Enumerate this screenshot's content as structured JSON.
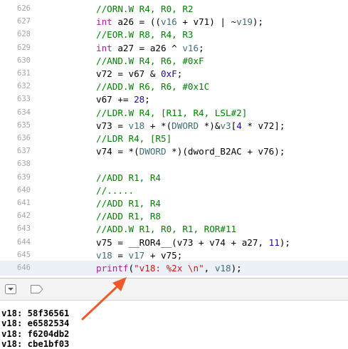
{
  "colors": {
    "comment": "#008000",
    "keyword": "#a3239d",
    "number": "#1c00cf",
    "variable": "#3f6e74",
    "string": "#c41a16",
    "arrow": "#f05a28"
  },
  "editor": {
    "lines": [
      {
        "n": "626",
        "tokens": [
          {
            "t": "//ORN.W R4, R0, R2",
            "c": "comment"
          }
        ]
      },
      {
        "n": "627",
        "tokens": [
          {
            "t": "int",
            "c": "kw"
          },
          {
            "t": " a26 = ((",
            "c": "plain"
          },
          {
            "t": "v16",
            "c": "var"
          },
          {
            "t": " + v71) | ~",
            "c": "plain"
          },
          {
            "t": "v19",
            "c": "var"
          },
          {
            "t": ");",
            "c": "plain"
          }
        ]
      },
      {
        "n": "628",
        "tokens": [
          {
            "t": "//EOR.W R8, R4, R3",
            "c": "comment"
          }
        ]
      },
      {
        "n": "629",
        "tokens": [
          {
            "t": "int",
            "c": "kw"
          },
          {
            "t": " a27 = a26 ^ ",
            "c": "plain"
          },
          {
            "t": "v16",
            "c": "var"
          },
          {
            "t": ";",
            "c": "plain"
          }
        ]
      },
      {
        "n": "630",
        "tokens": [
          {
            "t": "//AND.W R4, R6, #0xF",
            "c": "comment"
          }
        ]
      },
      {
        "n": "631",
        "tokens": [
          {
            "t": "v72 = v67 & ",
            "c": "plain"
          },
          {
            "t": "0xF",
            "c": "num"
          },
          {
            "t": ";",
            "c": "plain"
          }
        ]
      },
      {
        "n": "632",
        "tokens": [
          {
            "t": "//ADD.W R6, R6, #0x1C",
            "c": "comment"
          }
        ]
      },
      {
        "n": "633",
        "tokens": [
          {
            "t": "v67 += ",
            "c": "plain"
          },
          {
            "t": "28",
            "c": "num"
          },
          {
            "t": ";",
            "c": "plain"
          }
        ]
      },
      {
        "n": "634",
        "tokens": [
          {
            "t": "//LDR.W R4, [R11, R4, LSL#2]",
            "c": "comment"
          }
        ]
      },
      {
        "n": "635",
        "tokens": [
          {
            "t": "v73 = ",
            "c": "plain"
          },
          {
            "t": "v18",
            "c": "var"
          },
          {
            "t": " + *(",
            "c": "plain"
          },
          {
            "t": "DWORD",
            "c": "var"
          },
          {
            "t": " *)&",
            "c": "plain"
          },
          {
            "t": "v3",
            "c": "var"
          },
          {
            "t": "[",
            "c": "plain"
          },
          {
            "t": "4",
            "c": "num"
          },
          {
            "t": " * v72];",
            "c": "plain"
          }
        ]
      },
      {
        "n": "636",
        "tokens": [
          {
            "t": "//LDR R4, [R5]",
            "c": "comment"
          }
        ]
      },
      {
        "n": "637",
        "tokens": [
          {
            "t": "v74 = *(",
            "c": "plain"
          },
          {
            "t": "DWORD",
            "c": "var"
          },
          {
            "t": " *)(dword_B2AC + v76);",
            "c": "plain"
          }
        ]
      },
      {
        "n": "638",
        "tokens": []
      },
      {
        "n": "639",
        "tokens": [
          {
            "t": "//ADD R1, R4",
            "c": "comment"
          }
        ]
      },
      {
        "n": "640",
        "tokens": [
          {
            "t": "//.....",
            "c": "comment"
          }
        ]
      },
      {
        "n": "641",
        "tokens": [
          {
            "t": "//ADD R1, R4",
            "c": "comment"
          }
        ]
      },
      {
        "n": "642",
        "tokens": [
          {
            "t": "//ADD R1, R8",
            "c": "comment"
          }
        ]
      },
      {
        "n": "643",
        "tokens": [
          {
            "t": "//ADD.W R1, R0, R1, ROR#11",
            "c": "comment"
          }
        ]
      },
      {
        "n": "644",
        "tokens": [
          {
            "t": "v75 = __ROR4__(v73 + v74 + a27, ",
            "c": "plain"
          },
          {
            "t": "11",
            "c": "num"
          },
          {
            "t": ");",
            "c": "plain"
          }
        ]
      },
      {
        "n": "645",
        "tokens": [
          {
            "t": "v18",
            "c": "var"
          },
          {
            "t": " = ",
            "c": "plain"
          },
          {
            "t": "v17",
            "c": "var"
          },
          {
            "t": " + v75;",
            "c": "plain"
          }
        ]
      },
      {
        "n": "646",
        "tokens": [
          {
            "t": "printf",
            "c": "kw"
          },
          {
            "t": "(",
            "c": "plain"
          },
          {
            "t": "\"v18: %2x \\n\"",
            "c": "str"
          },
          {
            "t": ", ",
            "c": "plain"
          },
          {
            "t": "v18",
            "c": "var"
          },
          {
            "t": ");",
            "c": "plain"
          }
        ]
      }
    ]
  },
  "toolbar": {
    "hide_debug_icon": "chevron-down-square-icon",
    "breakpoint_icon": "breakpoint-tag-icon"
  },
  "console": {
    "lines": [
      "v18: 58f36561",
      "v18: e6582534",
      "v18: f6204db2",
      "v18: cbe1bf03"
    ]
  }
}
